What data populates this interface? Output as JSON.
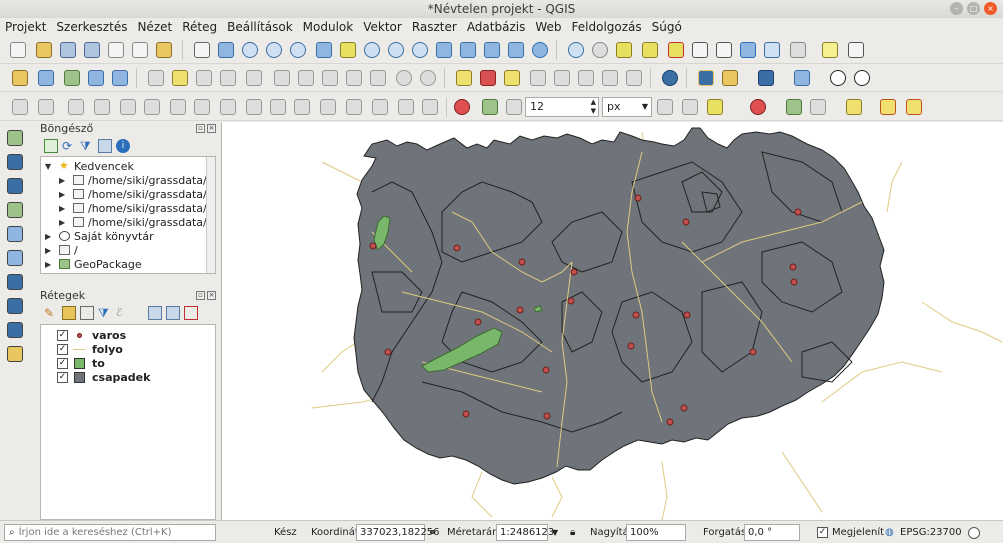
{
  "window": {
    "title": "*Névtelen projekt - QGIS"
  },
  "menu": [
    "Projekt",
    "Szerkesztés",
    "Nézet",
    "Réteg",
    "Beállítások",
    "Modulok",
    "Vektor",
    "Raszter",
    "Adatbázis",
    "Web",
    "Feldolgozás",
    "Súgó"
  ],
  "digitize": {
    "snap_tolerance": "12",
    "snap_unit": "px"
  },
  "browser_panel": {
    "title": "Böngésző",
    "items": [
      {
        "label": "Kedvencek",
        "icon": "star-icon"
      },
      {
        "label": "/home/siki/grassdata/te",
        "icon": "folder-icon"
      },
      {
        "label": "/home/siki/grassdata/te",
        "icon": "folder-icon"
      },
      {
        "label": "/home/siki/grassdata/te",
        "icon": "folder-icon"
      },
      {
        "label": "/home/siki/grassdata/te",
        "icon": "folder-icon"
      },
      {
        "label": "Saját könyvtár",
        "icon": "home-icon"
      },
      {
        "label": "/",
        "icon": "folder-icon"
      },
      {
        "label": "GeoPackage",
        "icon": "geopackage-icon"
      }
    ]
  },
  "layers_panel": {
    "title": "Rétegek",
    "layers": [
      {
        "name": "varos",
        "checked": true,
        "symbol": "point",
        "color": "#c0504d"
      },
      {
        "name": "folyo",
        "checked": true,
        "symbol": "line",
        "color": "#e0c982"
      },
      {
        "name": "to",
        "checked": true,
        "symbol": "fill",
        "color": "#79b86a"
      },
      {
        "name": "csapadek",
        "checked": true,
        "symbol": "fill",
        "color": "#6e7479"
      }
    ]
  },
  "status": {
    "search_placeholder": "Írjon ide a kereséshez (Ctrl+K)",
    "ready": "Kész",
    "coord_label": "Koordináta",
    "coord_value": "337023,182256",
    "scale_label": "Méretarány",
    "scale_value": "1:2486123",
    "magnifier_label": "Nagyítás",
    "magnifier_value": "100%",
    "rotation_label": "Forgatás",
    "rotation_value": "0,0 °",
    "render_label": "Megjelenít",
    "crs": "EPSG:23700"
  },
  "colors": {
    "country_fill": "#6e7479",
    "river": "#e0c982",
    "lake": "#79b86a",
    "city": "#c0504d"
  }
}
